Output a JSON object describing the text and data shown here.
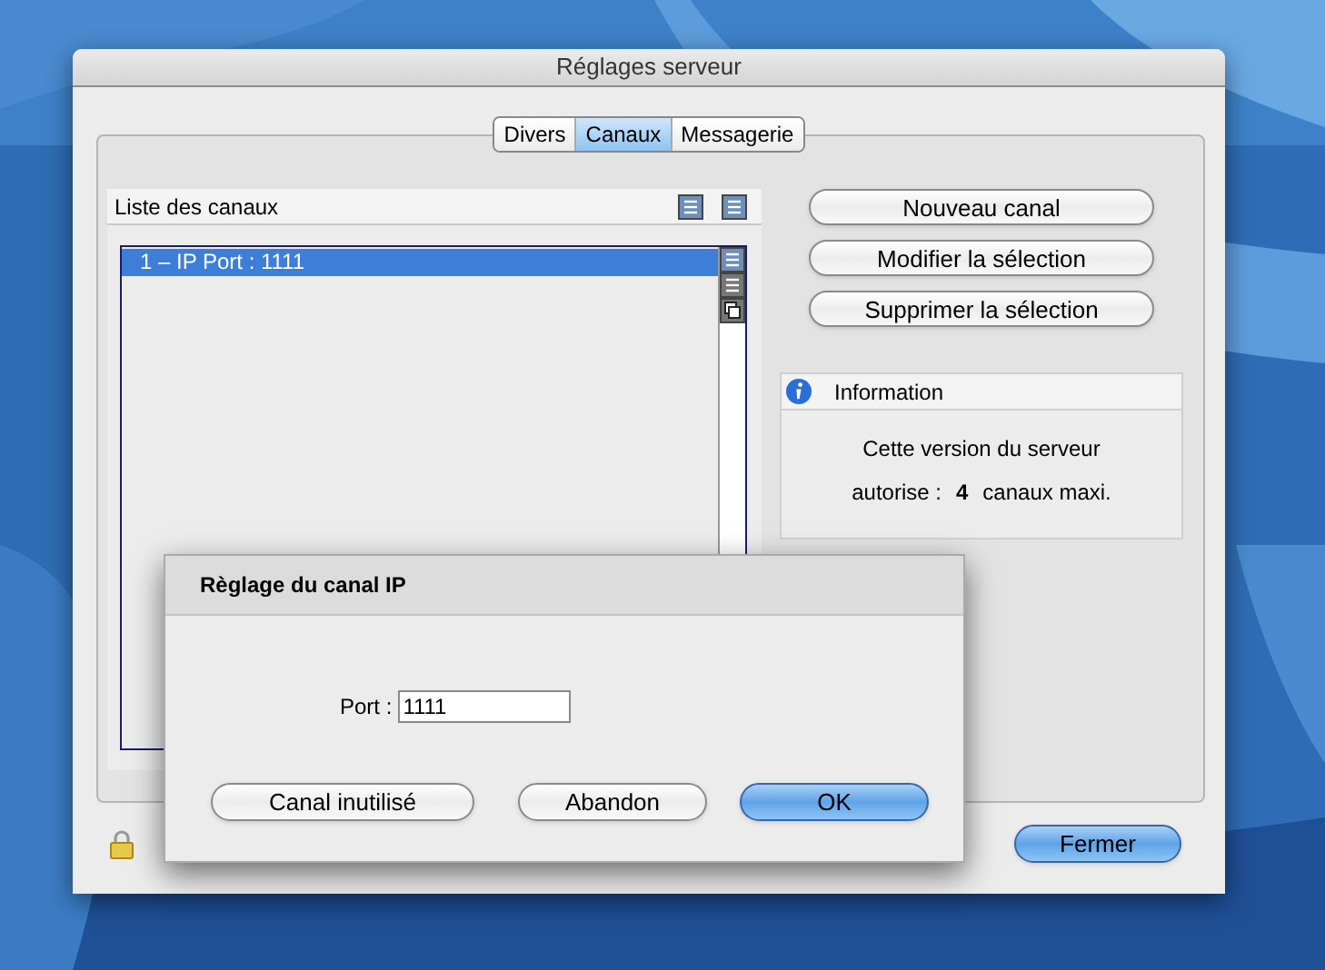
{
  "window": {
    "title": "Réglages serveur"
  },
  "tabs": [
    {
      "label": "Divers",
      "selected": false
    },
    {
      "label": "Canaux",
      "selected": true
    },
    {
      "label": "Messagerie",
      "selected": false
    }
  ],
  "channel_list": {
    "title": "Liste des canaux",
    "items": [
      {
        "label": "1 – IP Port : 1111",
        "selected": true
      }
    ]
  },
  "actions": [
    "Nouveau canal",
    "Modifier la sélection",
    "Supprimer la sélection"
  ],
  "information": {
    "title": "Information",
    "line_1": "Cette version du serveur",
    "line_2_prefix": "autorise :",
    "count": "4",
    "line_2_suffix": "canaux maxi."
  },
  "close_button": {
    "label": "Fermer",
    "default": true
  },
  "dialog": {
    "title": "Règlage du canal IP",
    "port_label": "Port :",
    "port_value": "1111",
    "buttons": [
      {
        "label": "Canal inutilisé",
        "default": false
      },
      {
        "label": "Abandon",
        "default": false
      },
      {
        "label": "OK",
        "default": true
      }
    ]
  }
}
